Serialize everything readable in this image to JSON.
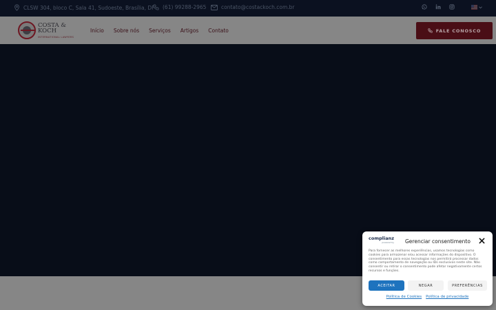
{
  "topbar": {
    "address": "CLSW 304, bloco C, Sala 41, Sudoeste, Brasília, DF",
    "phone": "(61) 99288-2965",
    "email": "contato@costackoch.com.br",
    "social_icons": [
      "whatsapp-icon",
      "linkedin-icon",
      "instagram-icon"
    ],
    "language_icon": "us-flag-icon"
  },
  "nav": {
    "logo_line1": "COSTA &",
    "logo_line2": "KOCH",
    "logo_sub": "INTERNATIONAL LAWYERS",
    "items": [
      {
        "label": "Início"
      },
      {
        "label": "Sobre nós"
      },
      {
        "label": "Serviços"
      },
      {
        "label": "Artigos"
      },
      {
        "label": "Contato"
      }
    ],
    "cta_label": "FALE CONOSCO"
  },
  "consent": {
    "brand": "complianz",
    "brand_sub": "powered by",
    "title": "Gerenciar consentimento",
    "text": "Para fornecer as melhores experiências, usamos tecnologias como cookies para armazenar e/ou acessar informações do dispositivo. O consentimento para essas tecnologias nos permitirá processar dados como comportamento de navegação ou IDs exclusivos neste site. Não consentir ou retirar o consentimento pode afetar negativamente certos recursos e funções.",
    "accept_label": "ACEITAR",
    "deny_label": "NEGAR",
    "preferences_label": "PREFERÊNCIAS",
    "cookie_policy_link": "Política de Cookies",
    "privacy_policy_link": "Política de privacidade"
  },
  "colors": {
    "dark_bg": "#080d18",
    "brand_wine": "#4a0e16",
    "accept_blue": "#1e73be"
  }
}
